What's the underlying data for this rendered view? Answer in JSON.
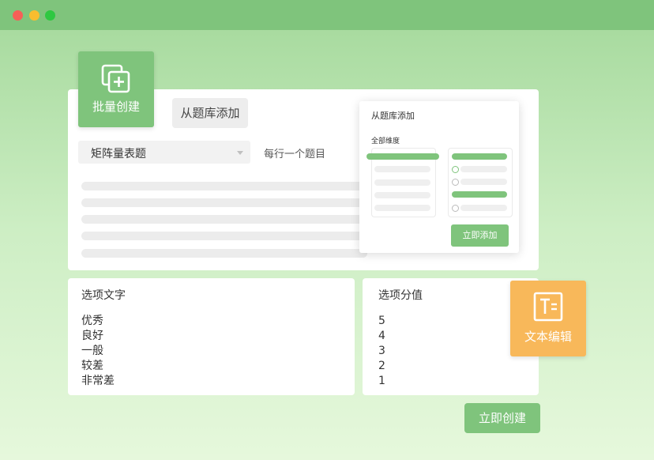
{
  "colors": {
    "accent_green": "#7fc47c",
    "accent_orange": "#f8b85a"
  },
  "batch_create": {
    "label": "批量创建",
    "icon": "copy-add-icon"
  },
  "library_tab": {
    "label": "从题库添加"
  },
  "question_type": {
    "selected": "矩阵量表题"
  },
  "hint": "每行一个题目",
  "library_popup": {
    "title": "从题库添加",
    "subtitle": "全部维度",
    "add_button": "立即添加"
  },
  "options_text": {
    "title": "选项文字",
    "items": [
      "优秀",
      "良好",
      "一般",
      "较差",
      "非常差"
    ]
  },
  "options_score": {
    "title": "选项分值",
    "items": [
      "5",
      "4",
      "3",
      "2",
      "1"
    ]
  },
  "text_edit": {
    "label": "文本编辑",
    "icon": "text-edit-icon"
  },
  "create_button": {
    "label": "立即创建"
  }
}
